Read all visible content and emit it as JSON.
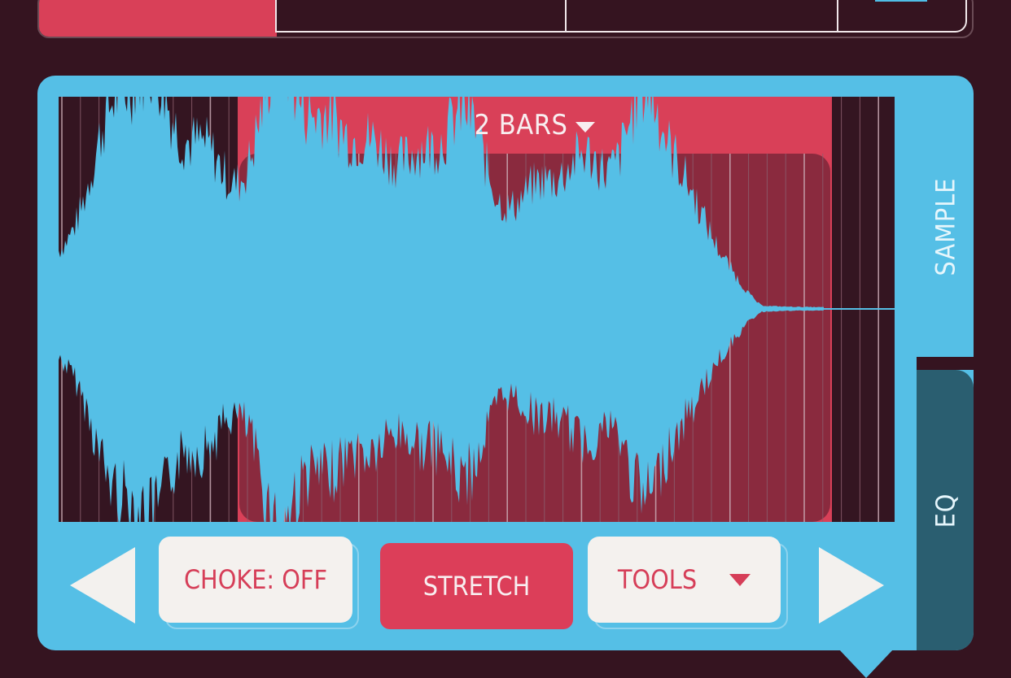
{
  "colors": {
    "background": "#351420",
    "accent_blue": "#55bfe6",
    "accent_red": "#d94058",
    "selection_fill": "#8a2a3e",
    "eq_tab": "#2a5e70",
    "button_white": "#f4f1ee"
  },
  "waveform": {
    "bar_length_label": "2 BARS"
  },
  "tabs": {
    "sample_label": "SAMPLE",
    "eq_label": "EQ"
  },
  "controls": {
    "choke_label": "CHOKE: OFF",
    "stretch_label": "STRETCH",
    "tools_label": "TOOLS"
  },
  "icons": {
    "prev": "triangle-left-icon",
    "next": "triangle-right-icon",
    "bars_dropdown": "chevron-down-icon",
    "tools_dropdown": "chevron-down-icon"
  }
}
